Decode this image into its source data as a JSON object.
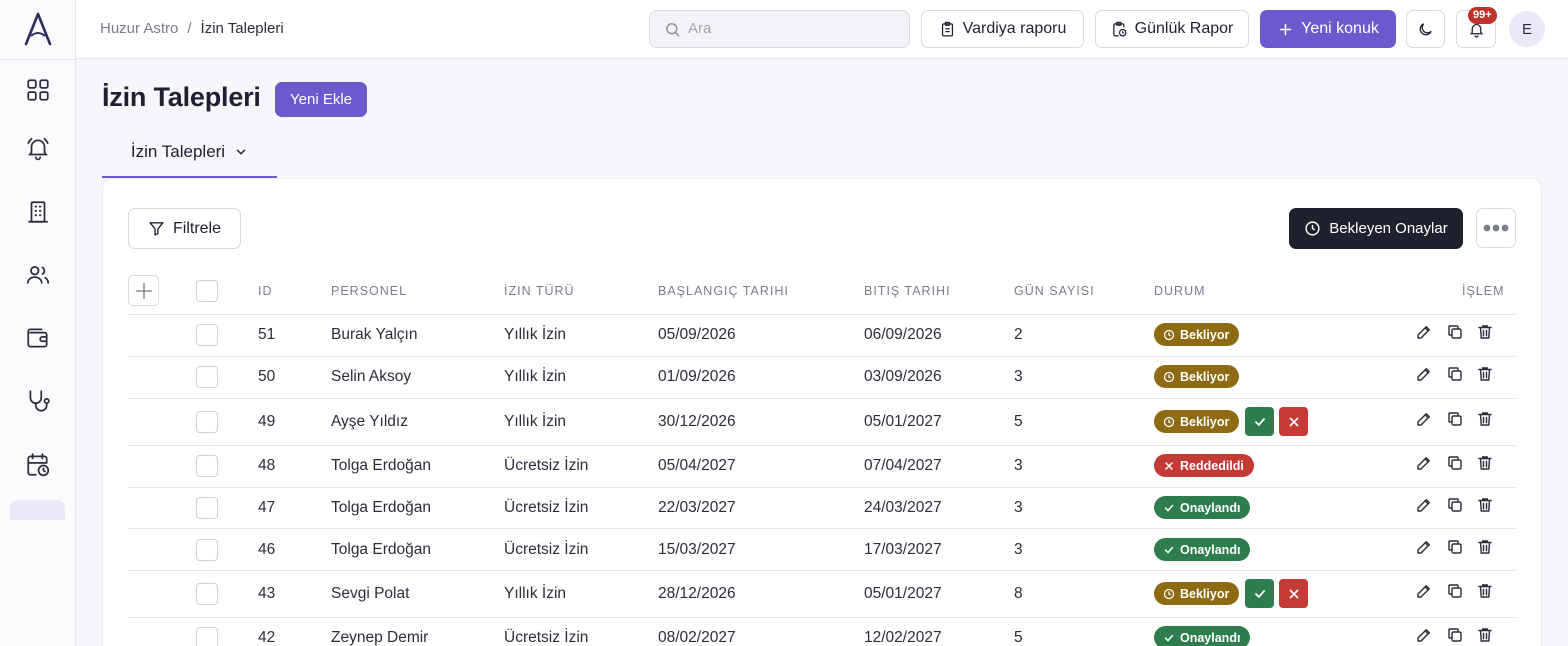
{
  "breadcrumb": {
    "root": "Huzur Astro",
    "separator": "/",
    "current": "İzin Talepleri"
  },
  "search": {
    "placeholder": "Ara"
  },
  "header": {
    "vardiya_label": "Vardiya raporu",
    "gunluk_label": "Günlük Rapor",
    "yeni_konuk_label": "Yeni konuk",
    "notification_count": "99+",
    "avatar_initial": "E"
  },
  "page": {
    "title": "İzin Talepleri",
    "add_label": "Yeni Ekle",
    "tab_label": "İzin Talepleri"
  },
  "toolbar": {
    "filter_label": "Filtrele",
    "pending_label": "Bekleyen Onaylar"
  },
  "table": {
    "columns": [
      "ID",
      "PERSONEL",
      "İZIN TÜRÜ",
      "BAŞLANGIÇ TARIHI",
      "BITIŞ TARIHI",
      "GÜN SAYISI",
      "DURUM",
      "İŞLEM"
    ],
    "rows": [
      {
        "id": "51",
        "personel": "Burak Yalçın",
        "tur": "Yıllık İzin",
        "baslangic": "05/09/2026",
        "bitis": "06/09/2026",
        "gun": "2",
        "durum": "Bekliyor"
      },
      {
        "id": "50",
        "personel": "Selin Aksoy",
        "tur": "Yıllık İzin",
        "baslangic": "01/09/2026",
        "bitis": "03/09/2026",
        "gun": "3",
        "durum": "Bekliyor"
      },
      {
        "id": "49",
        "personel": "Ayşe Yıldız",
        "tur": "Yıllık İzin",
        "baslangic": "30/12/2026",
        "bitis": "05/01/2027",
        "gun": "5",
        "durum": "Bekliyor"
      },
      {
        "id": "48",
        "personel": "Tolga Erdoğan",
        "tur": "Ücretsiz İzin",
        "baslangic": "05/04/2027",
        "bitis": "07/04/2027",
        "gun": "3",
        "durum": "Reddedildi"
      },
      {
        "id": "47",
        "personel": "Tolga Erdoğan",
        "tur": "Ücretsiz İzin",
        "baslangic": "22/03/2027",
        "bitis": "24/03/2027",
        "gun": "3",
        "durum": "Onaylandı"
      },
      {
        "id": "46",
        "personel": "Tolga Erdoğan",
        "tur": "Ücretsiz İzin",
        "baslangic": "15/03/2027",
        "bitis": "17/03/2027",
        "gun": "3",
        "durum": "Onaylandı"
      },
      {
        "id": "43",
        "personel": "Sevgi Polat",
        "tur": "Yıllık İzin",
        "baslangic": "28/12/2026",
        "bitis": "05/01/2027",
        "gun": "8",
        "durum": "Bekliyor"
      },
      {
        "id": "42",
        "personel": "Zeynep Demir",
        "tur": "Ücretsiz İzin",
        "baslangic": "08/02/2027",
        "bitis": "12/02/2027",
        "gun": "5",
        "durum": "Onaylandı"
      }
    ]
  },
  "colors": {
    "accent": "#6a5acd",
    "pending": "#8e6a12",
    "rejected": "#c43a35",
    "approved": "#2f7d4e"
  },
  "icons": {
    "sidebar": [
      "dashboard-icon",
      "alarm-bell-icon",
      "building-icon",
      "users-icon",
      "wallet-icon",
      "stethoscope-icon",
      "calendar-clock-icon"
    ],
    "row_actions": [
      "edit-icon",
      "copy-icon",
      "trash-icon"
    ]
  }
}
